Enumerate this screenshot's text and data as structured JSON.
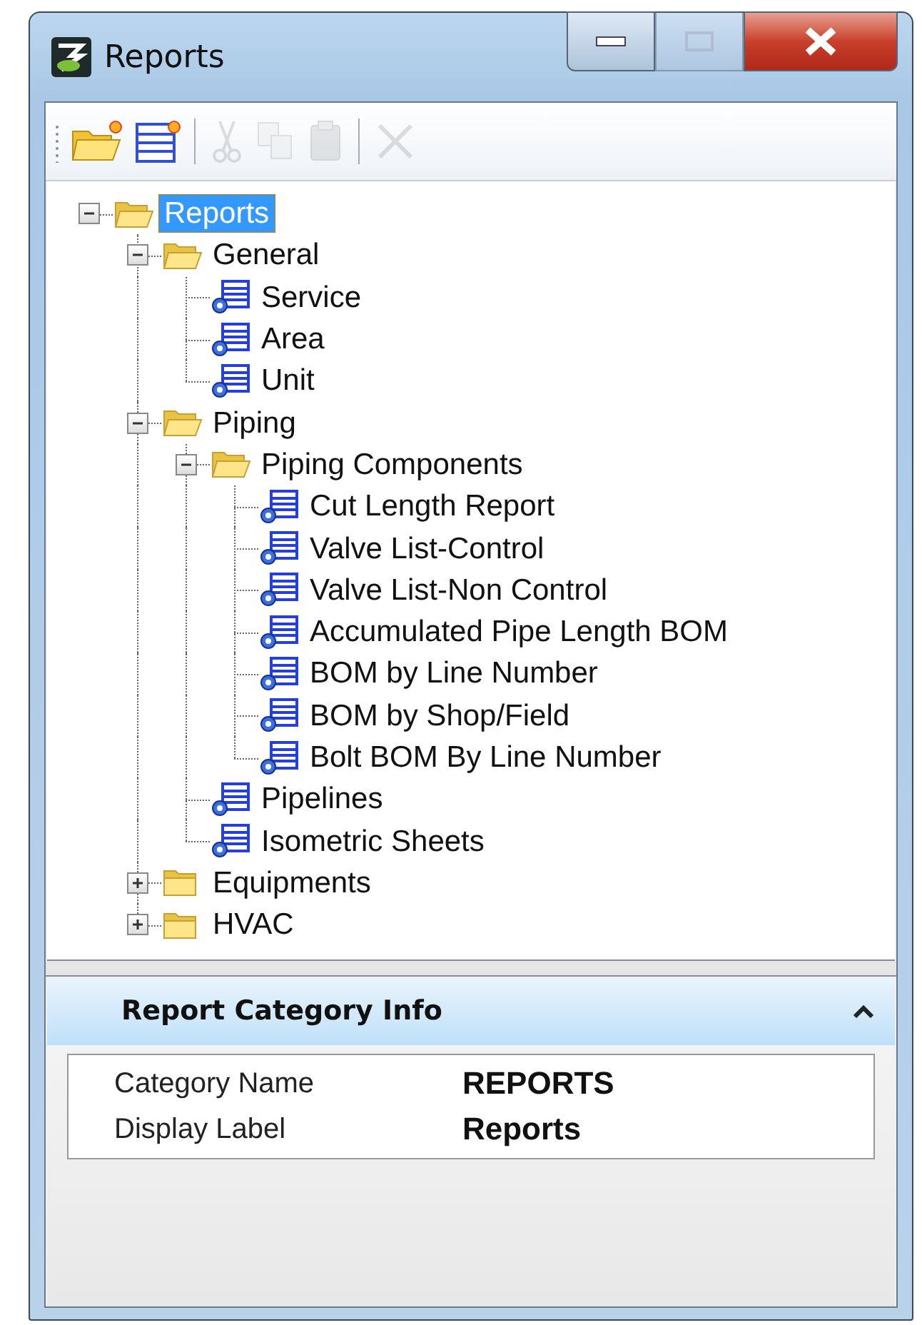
{
  "window": {
    "title": "Reports"
  },
  "window_controls": [
    {
      "kind": "minimize",
      "disabled": false
    },
    {
      "kind": "maximize",
      "disabled": true
    },
    {
      "kind": "close",
      "disabled": false
    }
  ],
  "toolbar": [
    {
      "kind": "new-folder",
      "disabled": false
    },
    {
      "kind": "new-report",
      "disabled": false
    },
    {
      "kind": "separator"
    },
    {
      "kind": "cut",
      "disabled": true
    },
    {
      "kind": "copy",
      "disabled": true
    },
    {
      "kind": "paste",
      "disabled": true
    },
    {
      "kind": "separator"
    },
    {
      "kind": "delete",
      "disabled": true
    }
  ],
  "tree": [
    {
      "label": "Reports",
      "kind": "folder",
      "expanded": true,
      "selected": true,
      "children": [
        {
          "label": "General",
          "kind": "folder",
          "expanded": true,
          "selected": false,
          "children": [
            {
              "label": "Service",
              "kind": "report",
              "selected": false
            },
            {
              "label": "Area",
              "kind": "report",
              "selected": false
            },
            {
              "label": "Unit",
              "kind": "report",
              "selected": false
            }
          ]
        },
        {
          "label": "Piping",
          "kind": "folder",
          "expanded": true,
          "selected": false,
          "children": [
            {
              "label": "Piping Components",
              "kind": "folder",
              "expanded": true,
              "selected": false,
              "children": [
                {
                  "label": "Cut Length Report",
                  "kind": "report",
                  "selected": false
                },
                {
                  "label": "Valve List-Control",
                  "kind": "report",
                  "selected": false
                },
                {
                  "label": "Valve List-Non Control",
                  "kind": "report",
                  "selected": false
                },
                {
                  "label": "Accumulated Pipe Length BOM",
                  "kind": "report",
                  "selected": false
                },
                {
                  "label": "BOM by Line Number",
                  "kind": "report",
                  "selected": false
                },
                {
                  "label": "BOM by Shop/Field",
                  "kind": "report",
                  "selected": false
                },
                {
                  "label": "Bolt BOM By Line Number",
                  "kind": "report",
                  "selected": false
                }
              ]
            },
            {
              "label": "Pipelines",
              "kind": "report",
              "selected": false
            },
            {
              "label": "Isometric Sheets",
              "kind": "report",
              "selected": false
            }
          ]
        },
        {
          "label": "Equipments",
          "kind": "folder",
          "expanded": false,
          "selected": false
        },
        {
          "label": "HVAC",
          "kind": "folder",
          "expanded": false,
          "selected": false
        }
      ]
    }
  ],
  "info_panel": {
    "title": "Report Category Info",
    "expanded": true,
    "properties": [
      {
        "label": "Category Name",
        "value": "REPORTS"
      },
      {
        "label": "Display Label",
        "value": "Reports"
      }
    ]
  }
}
